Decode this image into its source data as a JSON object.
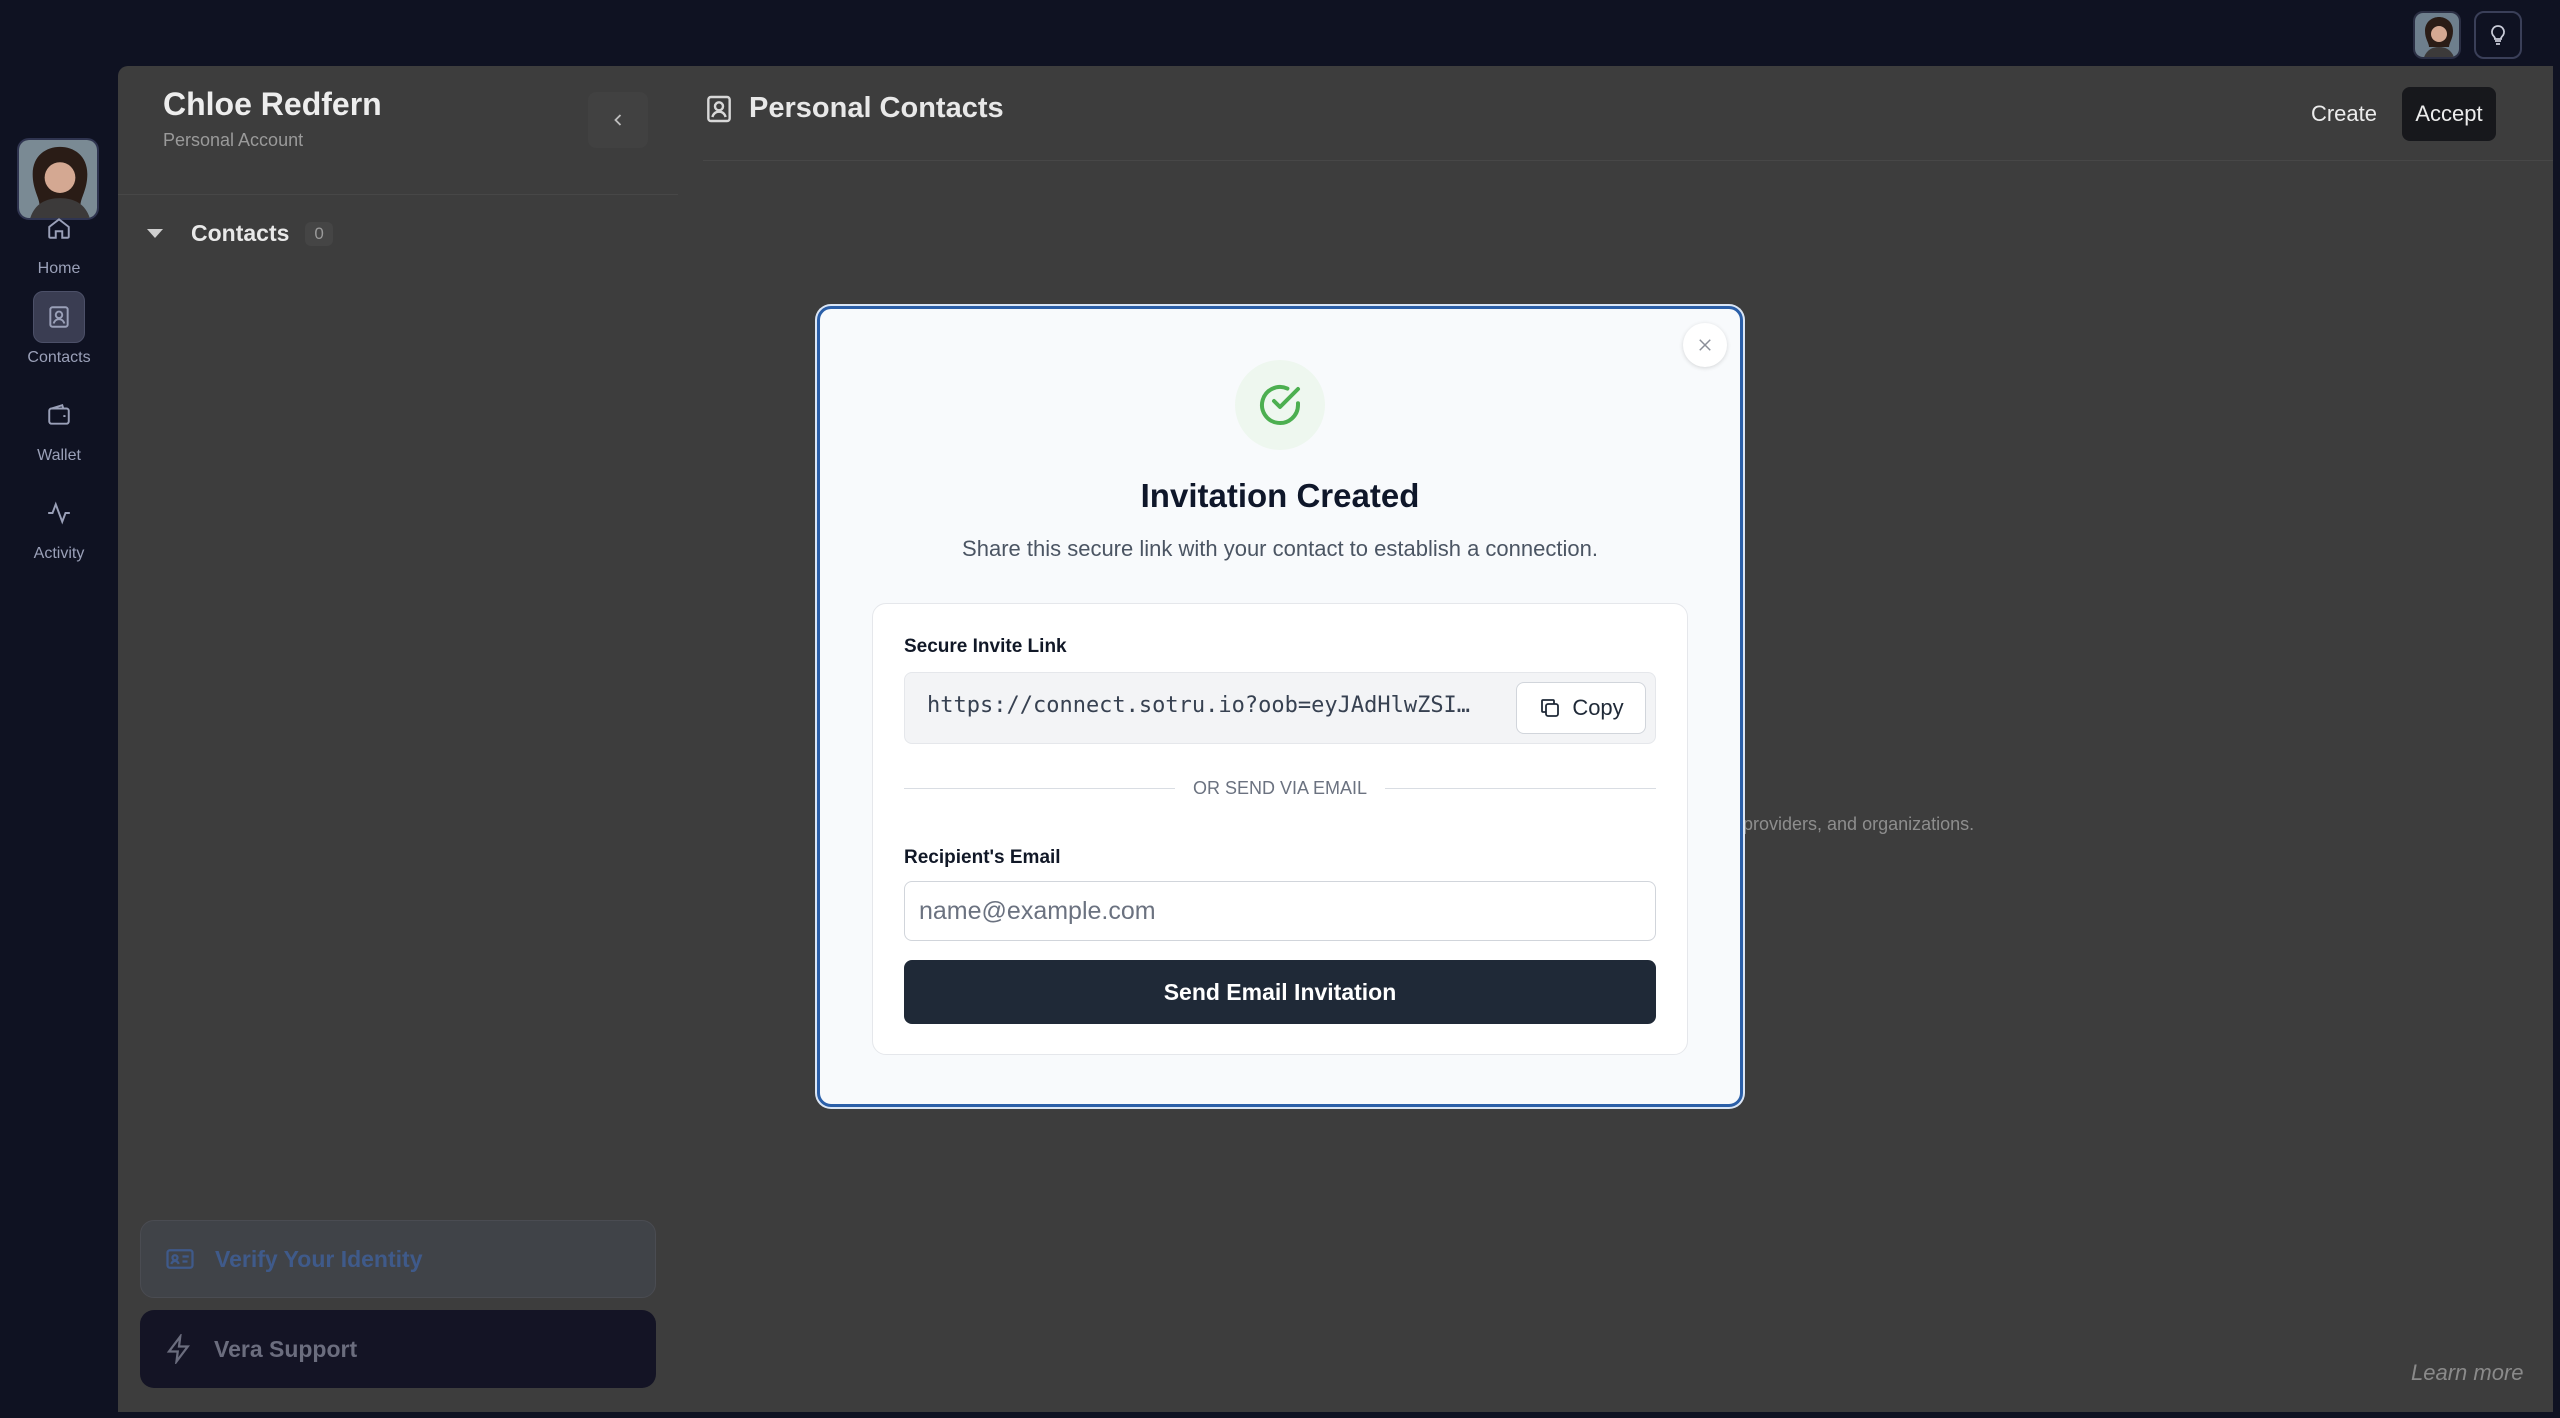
{
  "user": {
    "name": "Chloe Redfern",
    "account_type": "Personal Account"
  },
  "rail": {
    "items": [
      {
        "label": "Home",
        "icon": "home-icon"
      },
      {
        "label": "Contacts",
        "icon": "contacts-icon"
      },
      {
        "label": "Wallet",
        "icon": "wallet-icon"
      },
      {
        "label": "Activity",
        "icon": "activity-icon"
      }
    ]
  },
  "sidebar": {
    "section_label": "Contacts",
    "section_count": "0",
    "verify_label": "Verify Your Identity",
    "support_label": "Vera Support"
  },
  "content": {
    "title": "Personal Contacts",
    "create_label": "Create",
    "accept_label": "Accept",
    "background_text": "providers, and organizations.",
    "learn_more": "Learn more"
  },
  "modal": {
    "title": "Invitation Created",
    "subtitle": "Share this secure link with your contact to establish a connection.",
    "link_label": "Secure Invite Link",
    "link_value": "https://connect.sotru.io?oob=eyJAdHlwZSI…",
    "copy_label": "Copy",
    "divider_label": "OR SEND VIA EMAIL",
    "email_label": "Recipient's Email",
    "email_placeholder": "name@example.com",
    "email_value": "",
    "send_label": "Send Email Invitation"
  },
  "colors": {
    "accent_check": "#4caf50",
    "modal_border": "#2b5fa8",
    "primary_button": "#1f2937"
  }
}
